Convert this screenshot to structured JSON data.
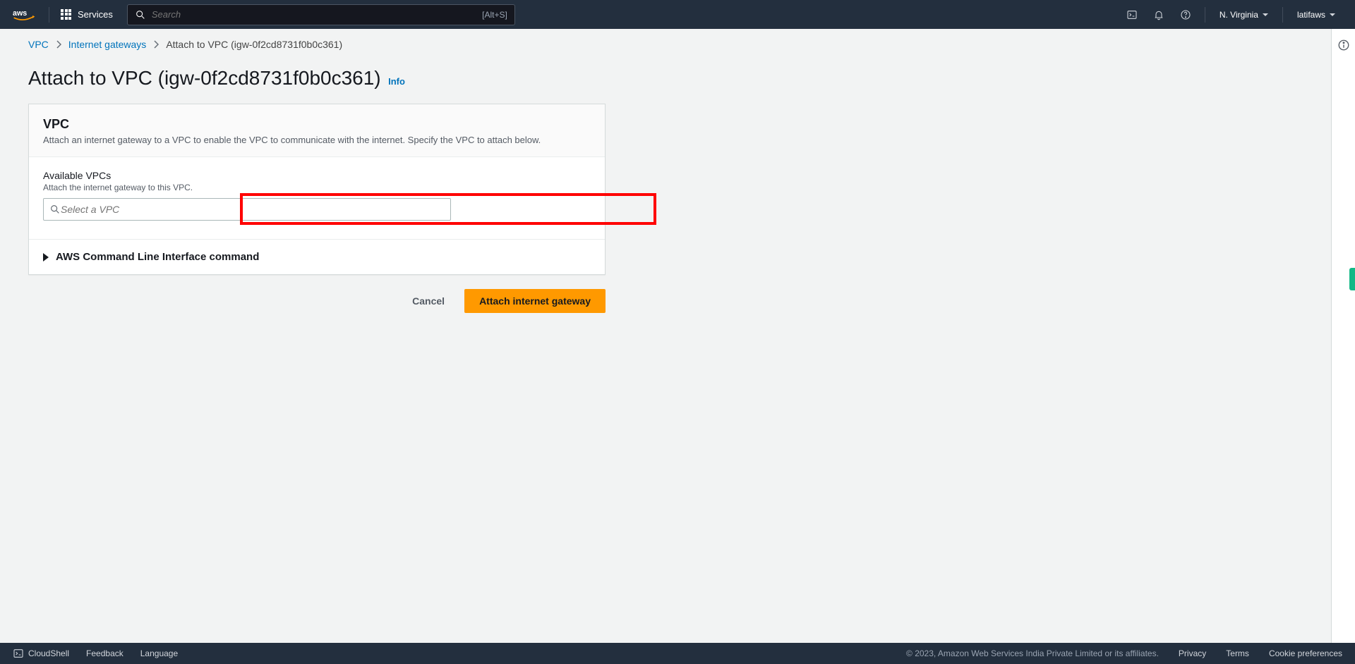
{
  "topnav": {
    "services_label": "Services",
    "search_placeholder": "Search",
    "search_hint": "[Alt+S]",
    "region": "N. Virginia",
    "user": "latifaws"
  },
  "breadcrumb": {
    "item1": "VPC",
    "item2": "Internet gateways",
    "current": "Attach to VPC (igw-0f2cd8731f0b0c361)"
  },
  "page": {
    "title": "Attach to VPC (igw-0f2cd8731f0b0c361)",
    "info": "Info"
  },
  "panel": {
    "heading": "VPC",
    "description": "Attach an internet gateway to a VPC to enable the VPC to communicate with the internet. Specify the VPC to attach below.",
    "field_label": "Available VPCs",
    "field_hint": "Attach the internet gateway to this VPC.",
    "select_placeholder": "Select a VPC",
    "cli_label": "AWS Command Line Interface command"
  },
  "actions": {
    "cancel": "Cancel",
    "submit": "Attach internet gateway"
  },
  "footer": {
    "cloudshell": "CloudShell",
    "feedback": "Feedback",
    "language": "Language",
    "copyright": "© 2023, Amazon Web Services India Private Limited or its affiliates.",
    "privacy": "Privacy",
    "terms": "Terms",
    "cookies": "Cookie preferences"
  }
}
